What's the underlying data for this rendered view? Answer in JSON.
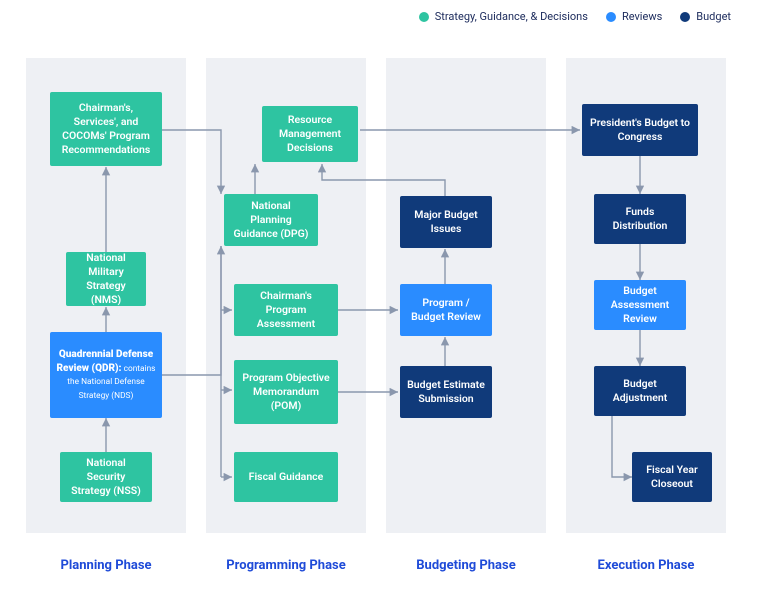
{
  "legend": {
    "a": "Strategy, Guidance, & Decisions",
    "b": "Reviews",
    "c": "Budget"
  },
  "phases": {
    "planning": "Planning Phase",
    "programming": "Programming Phase",
    "budgeting": "Budgeting Phase",
    "execution": "Execution Phase"
  },
  "boxes": {
    "recs": "Chairman's, Services', and COCOMs' Program Recommendations",
    "nms": "National Military Strategy (NMS)",
    "qdr_title": "Quadrennial Defense Review (QDR):",
    "qdr_sub": " contains the National Defense Strategy (NDS)",
    "nss": "National Security Strategy (NSS)",
    "rmd": "Resource Management Decisions",
    "dpg": "National Planning Guidance (DPG)",
    "cpa": "Chairman's Program Assessment",
    "pom": "Program Objective Memorandum (POM)",
    "fiscal": "Fiscal Guidance",
    "mbi": "Major Budget Issues",
    "pbr": "Program / Budget Review",
    "bes": "Budget Estimate Submission",
    "pbc": "President's Budget to Congress",
    "funds": "Funds Distribution",
    "bar": "Budget Assessment Review",
    "badj": "Budget Adjustment",
    "fyc": "Fiscal Year Closeout"
  }
}
